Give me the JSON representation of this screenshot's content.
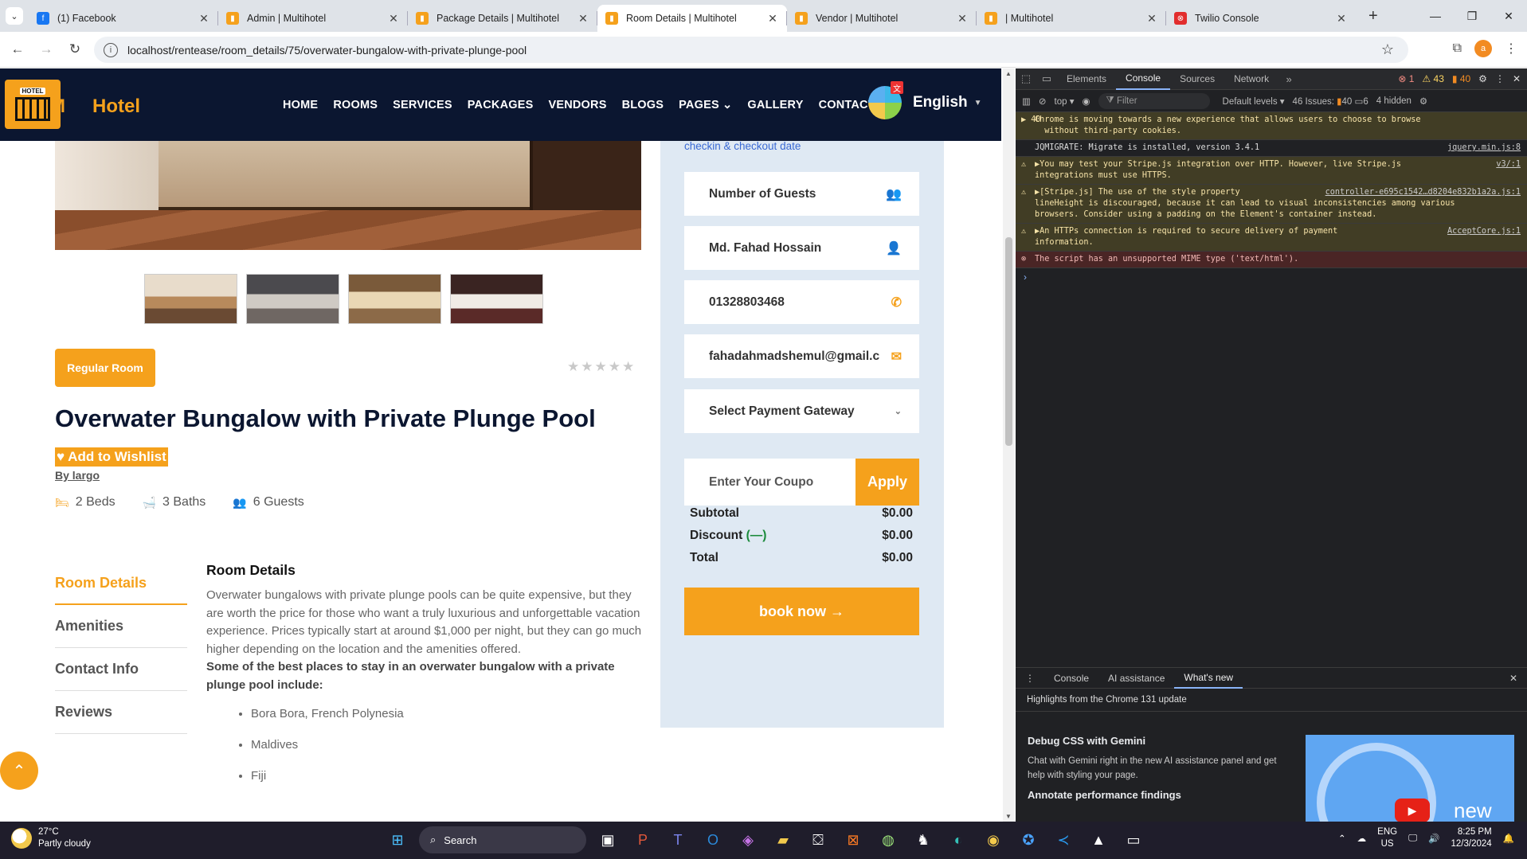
{
  "browser": {
    "tabs": [
      {
        "title": "(1) Facebook",
        "fav_color": "#1877f2",
        "fav_glyph": "f"
      },
      {
        "title": "Admin | Multihotel",
        "fav_color": "#f5a11c",
        "fav_glyph": "▮"
      },
      {
        "title": "Package Details | Multihotel",
        "fav_color": "#f5a11c",
        "fav_glyph": "▮"
      },
      {
        "title": "Room Details | Multihotel",
        "fav_color": "#f5a11c",
        "fav_glyph": "▮"
      },
      {
        "title": "Vendor | Multihotel",
        "fav_color": "#f5a11c",
        "fav_glyph": "▮"
      },
      {
        "title": "| Multihotel",
        "fav_color": "#f5a11c",
        "fav_glyph": "▮"
      },
      {
        "title": "Twilio Console",
        "fav_color": "#e22d2d",
        "fav_glyph": "⊗"
      }
    ],
    "active_tab": 3,
    "url": "localhost/rentease/room_details/75/overwater-bungalow-with-private-plunge-pool",
    "profile_initial": "a"
  },
  "site": {
    "logo_badge": "HOTEL",
    "logo_letter": "M",
    "logo_word": "Hotel",
    "nav": [
      "HOME",
      "ROOMS",
      "SERVICES",
      "PACKAGES",
      "VENDORS",
      "BLOGS",
      "PAGES ⌄",
      "GALLERY",
      "CONTACT"
    ],
    "language": "English"
  },
  "room": {
    "type_badge": "Regular Room",
    "rating_stars": "★★★★★",
    "title": "Overwater Bungalow with Private Plunge Pool",
    "wishlist_label": "♥ Add to Wishlist",
    "by_label": "By largo",
    "features": {
      "beds": "2 Beds",
      "baths": "3 Baths",
      "guests": "6 Guests"
    },
    "tabs": [
      "Room Details",
      "Amenities",
      "Contact Info",
      "Reviews"
    ],
    "details_heading": "Room Details",
    "details_para": "Overwater bungalows with private plunge pools can be quite expensive, but they are worth the price for those who want a truly luxurious and unforgettable vacation experience. Prices typically start at around $1,000 per night, but they can go much higher depending on the location and the amenities offered.",
    "details_bold": "Some of the best places to stay in an overwater bungalow with a private plunge pool include:",
    "places": [
      "Bora Bora, French Polynesia",
      "Maldives",
      "Fiji"
    ]
  },
  "booking": {
    "hint": "checkin & checkout date",
    "guests_placeholder": "Number of Guests",
    "name_value": "Md. Fahad Hossain",
    "phone_value": "01328803468",
    "email_value": "fahadahmadshemul@gmail.c",
    "payment_placeholder": "Select Payment Gateway",
    "coupon_placeholder": "Enter Your Coupo",
    "apply_label": "Apply",
    "subtotal_label": "Subtotal",
    "subtotal_value": "$0.00",
    "discount_label": "Discount",
    "discount_sign": "(—)",
    "discount_value": "$0.00",
    "total_label": "Total",
    "total_value": "$0.00",
    "book_label": "book now →"
  },
  "devtools": {
    "tabs": [
      "Elements",
      "Console",
      "Sources",
      "Network"
    ],
    "active_tab": 1,
    "counts": {
      "errors": "1",
      "warnings": "43",
      "issues": "40"
    },
    "context": "top ▾",
    "filter_placeholder": "Filter",
    "levels": "Default levels ▾",
    "issues_label": "46 Issues:",
    "issues_a": "40",
    "issues_b": "6",
    "hidden": "4 hidden",
    "messages": [
      {
        "kind": "warn",
        "badge": "▶ 40",
        "text": "Chrome is moving towards a new experience that allows users to choose to browse\n  without third-party cookies.",
        "src": ""
      },
      {
        "kind": "info",
        "badge": "",
        "text": "JQMIGRATE: Migrate is installed, version 3.4.1",
        "src": "jquery.min.js:8"
      },
      {
        "kind": "warn",
        "badge": "⚠",
        "text": "▶You may test your Stripe.js integration over HTTP. However, live Stripe.js\nintegrations must use HTTPS.",
        "src": "v3/:1"
      },
      {
        "kind": "warn",
        "badge": "⚠",
        "text": "▶[Stripe.js] The use of the style property\nlineHeight is discouraged, because it can lead to visual inconsistencies among various\nbrowsers. Consider using a padding on the Element's container instead.",
        "src": "controller-e695c1542…d8204e832b1a2a.js:1"
      },
      {
        "kind": "warn",
        "badge": "⚠",
        "text": "▶An HTTPs connection is required to secure delivery of payment\ninformation.",
        "src": "AcceptCore.js:1"
      },
      {
        "kind": "err",
        "badge": "⊗",
        "text": "The script has an unsupported MIME type ('text/html').",
        "src": ""
      }
    ],
    "drawer_tabs": [
      "Console",
      "AI assistance",
      "What's new"
    ],
    "drawer_heading": "Highlights from the Chrome 131 update",
    "wn1_title": "Debug CSS with Gemini",
    "wn1_text": "Chat with Gemini right in the new AI assistance panel and get help with styling your page.",
    "wn2_title": "Annotate performance findings",
    "video_label": "new"
  },
  "taskbar": {
    "temp": "27°C",
    "weather": "Partly cloudy",
    "search": "Search",
    "lang_top": "ENG",
    "lang_bottom": "US",
    "time": "8:25 PM",
    "date": "12/3/2024"
  }
}
